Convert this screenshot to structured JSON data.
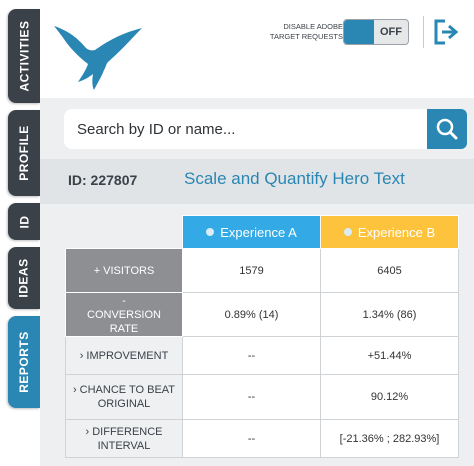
{
  "sidebar": {
    "tabs": [
      {
        "label": "ACTIVITIES"
      },
      {
        "label": "PROFILE"
      },
      {
        "label": "ID"
      },
      {
        "label": "IDEAS"
      },
      {
        "label": "REPORTS"
      }
    ]
  },
  "header": {
    "logo_icon": "bird-logo-icon",
    "adobe_toggle_label_line1": "DISABLE ADOBE",
    "adobe_toggle_label_line2": "TARGET REQUESTS",
    "toggle_state": "OFF",
    "logout_icon": "logout-icon"
  },
  "search": {
    "placeholder": "Search by ID or name...",
    "value": "",
    "icon": "search-icon"
  },
  "activity": {
    "id_label": "ID: 227807",
    "name": "Scale and Quantify Hero Text"
  },
  "results": {
    "columns": [
      "Experience A",
      "Experience B"
    ],
    "rows": [
      {
        "label": "+ VISITORS",
        "a": "1579",
        "b": "6405"
      },
      {
        "label": "- CONVERSION RATE",
        "a": "0.89% (14)",
        "b": "1.34% (86)"
      },
      {
        "label": "› IMPROVEMENT",
        "a": "--",
        "b": "+51.44%"
      },
      {
        "label": "› CHANCE TO BEAT ORIGINAL",
        "a": "--",
        "b": "90.12%"
      },
      {
        "label": "› DIFFERENCE INTERVAL",
        "a": "--",
        "b": "[-21.36% ; 282.93%]"
      }
    ]
  },
  "colors": {
    "brand_blue": "#2a86b3",
    "dark_tab": "#3b4148",
    "experience_a": "#33a9e6",
    "experience_b": "#fdc33c",
    "metric_label_bg": "#8d8f92"
  }
}
